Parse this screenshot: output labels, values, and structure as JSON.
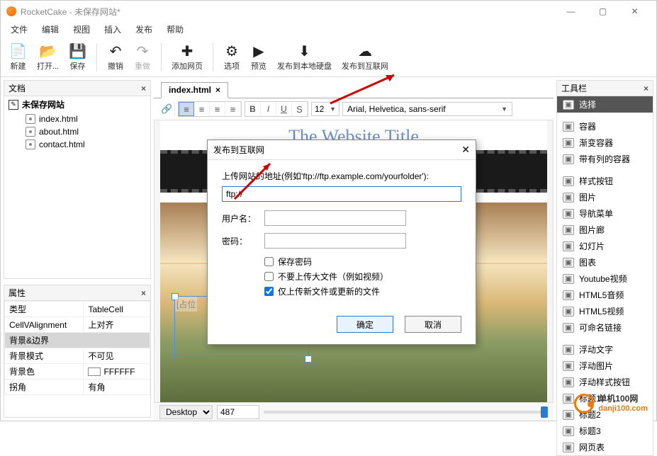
{
  "window": {
    "app_name": "RocketCake",
    "title_suffix": " - 未保存网站*"
  },
  "menu": [
    "文件",
    "编辑",
    "视图",
    "插入",
    "发布",
    "帮助"
  ],
  "toolbar": [
    {
      "id": "new",
      "icon": "📄",
      "label": "新建"
    },
    {
      "id": "open",
      "icon": "📂",
      "label": "打开..."
    },
    {
      "id": "save",
      "icon": "💾",
      "label": "保存"
    },
    {
      "sep": true
    },
    {
      "id": "undo",
      "icon": "↶",
      "label": "撤销"
    },
    {
      "id": "redo",
      "icon": "↷",
      "label": "重做",
      "disabled": true
    },
    {
      "sep": true
    },
    {
      "id": "add-page",
      "icon": "✚",
      "label": "添加网页"
    },
    {
      "sep": true
    },
    {
      "id": "options",
      "icon": "⚙",
      "label": "选项"
    },
    {
      "id": "preview",
      "icon": "▶",
      "label": "预览"
    },
    {
      "id": "publish-local",
      "icon": "⬇",
      "label": "发布到本地硬盘"
    },
    {
      "id": "publish-web",
      "icon": "☁",
      "label": "发布到互联网"
    }
  ],
  "docs_panel": {
    "title": "文档",
    "root": "未保存网站",
    "items": [
      "index.html",
      "about.html",
      "contact.html"
    ]
  },
  "props_panel": {
    "title": "属性",
    "rows": [
      {
        "k": "类型",
        "v": "TableCell"
      },
      {
        "k": "CellVAlignment",
        "v": "上对齐"
      },
      {
        "group": "背景&边界"
      },
      {
        "k": "背景模式",
        "v": "不可见"
      },
      {
        "k": "背景色",
        "v": "FFFFFF",
        "color": true
      },
      {
        "k": "拐角",
        "v": "有角"
      }
    ]
  },
  "tabs": {
    "active": "index.html"
  },
  "editor_toolbar": {
    "font_size": "12",
    "font_family": "Arial, Helvetica, sans-serif"
  },
  "canvas": {
    "site_title": "The Website Title",
    "placeholder": "[占位",
    "view_mode": "Desktop",
    "width_value": "487"
  },
  "modal": {
    "title": "发布到互联网",
    "hint": "上传网站的地址(例如'ftp://ftp.example.com/yourfolder'):",
    "address_value": "ftp://",
    "username_label": "用户名：",
    "password_label": "密码：",
    "cb_save_pw": "保存密码",
    "cb_skip_big": "不要上传大文件（例如视频）",
    "cb_only_new": "仅上传新文件或更新的文件",
    "ok": "确定",
    "cancel": "取消"
  },
  "toolbox": {
    "title": "工具栏",
    "groups": [
      [
        {
          "id": "select",
          "label": "选择",
          "selected": true
        }
      ],
      [
        {
          "id": "container",
          "label": "容器"
        },
        {
          "id": "gradient-container",
          "label": "渐变容器"
        },
        {
          "id": "column-container",
          "label": "带有列的容器"
        }
      ],
      [
        {
          "id": "style-button",
          "label": "样式按钮"
        },
        {
          "id": "image",
          "label": "图片"
        },
        {
          "id": "nav-menu",
          "label": "导航菜单"
        },
        {
          "id": "gallery",
          "label": "图片廊"
        },
        {
          "id": "slideshow",
          "label": "幻灯片"
        },
        {
          "id": "chart",
          "label": "图表"
        },
        {
          "id": "youtube",
          "label": "Youtube视频"
        },
        {
          "id": "html5-audio",
          "label": "HTML5音频"
        },
        {
          "id": "html5-video",
          "label": "HTML5视频"
        },
        {
          "id": "named-link",
          "label": "可命名链接"
        }
      ],
      [
        {
          "id": "float-text",
          "label": "浮动文字"
        },
        {
          "id": "float-image",
          "label": "浮动图片"
        },
        {
          "id": "float-style-btn",
          "label": "浮动样式按钮"
        },
        {
          "id": "h1",
          "label": "标题1"
        },
        {
          "id": "h2",
          "label": "标题2"
        },
        {
          "id": "h3",
          "label": "标题3"
        },
        {
          "id": "webtable",
          "label": "网页表"
        }
      ]
    ]
  },
  "watermark": "单机100网\ndanji100.com"
}
